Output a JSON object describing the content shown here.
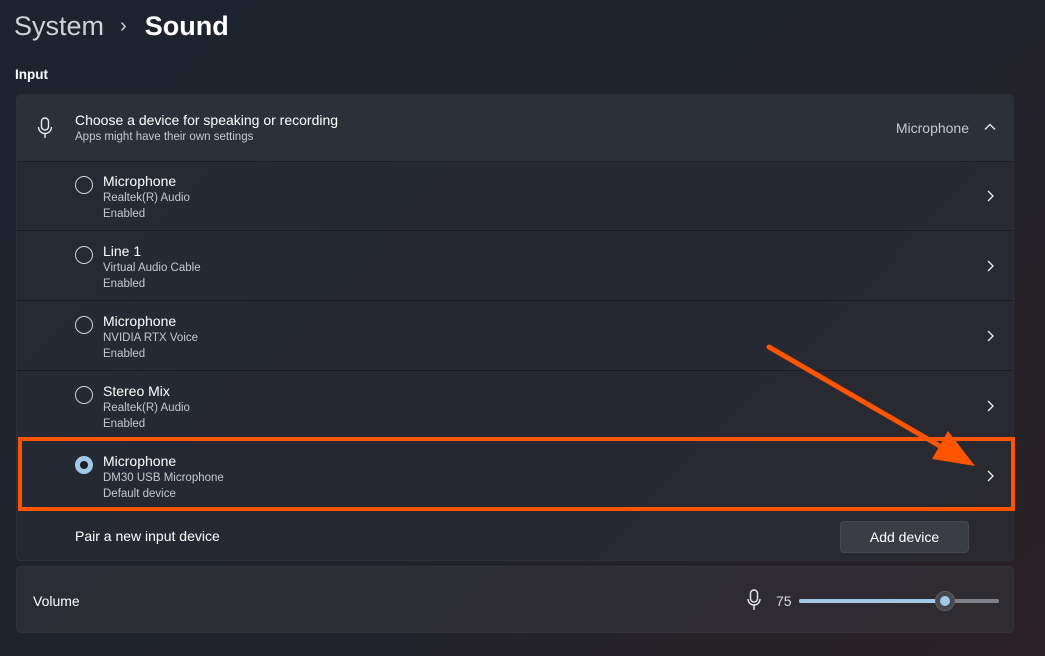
{
  "breadcrumb": {
    "parent": "System",
    "separator": "›",
    "current": "Sound"
  },
  "section": {
    "label": "Input"
  },
  "input_panel": {
    "title": "Choose a device for speaking or recording",
    "subtitle": "Apps might have their own settings",
    "selected_value": "Microphone",
    "devices": [
      {
        "name": "Microphone",
        "sub": "Realtek(R) Audio",
        "status": "Enabled",
        "selected": false
      },
      {
        "name": "Line 1",
        "sub": "Virtual Audio Cable",
        "status": "Enabled",
        "selected": false
      },
      {
        "name": "Microphone",
        "sub": "NVIDIA RTX Voice",
        "status": "Enabled",
        "selected": false
      },
      {
        "name": "Stereo Mix",
        "sub": "Realtek(R) Audio",
        "status": "Enabled",
        "selected": false
      },
      {
        "name": "Microphone",
        "sub": "DM30 USB Microphone",
        "status": "Default device",
        "selected": true
      }
    ],
    "pair_label": "Pair a new input device",
    "add_button": "Add device"
  },
  "volume": {
    "label": "Volume",
    "value": "75",
    "level": 0.73
  },
  "colors": {
    "accent": "#9fc9e6",
    "annotation": "#ff5400"
  },
  "icons": {
    "microphone": "microphone-icon",
    "chevron_up": "chevron-up-icon",
    "chevron_right": "chevron-right-icon"
  }
}
